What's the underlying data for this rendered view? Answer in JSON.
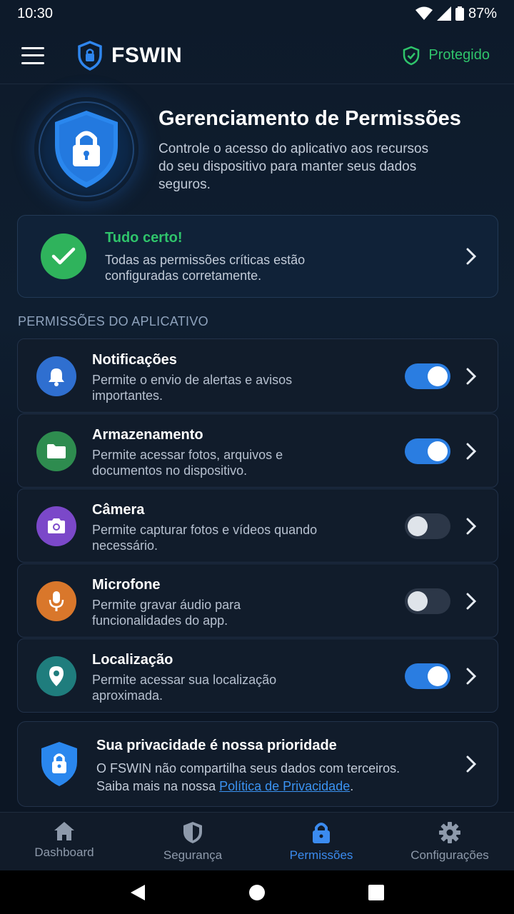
{
  "status_bar": {
    "time": "10:30",
    "battery": "87%"
  },
  "app_bar": {
    "brand": "FSWIN",
    "status": "Protegido"
  },
  "hero": {
    "title": "Gerenciamento de Permissões",
    "description": "Controle o acesso do aplicativo aos recursos do seu dispositivo para manter seus dados seguros."
  },
  "status_card": {
    "title": "Tudo certo!",
    "description": "Todas as permissões críticas estão configuradas corretamente."
  },
  "section_label": "PERMISSÕES DO APLICATIVO",
  "permissions": [
    {
      "title": "Notificações",
      "description": "Permite o envio de alertas e avisos importantes.",
      "enabled": true,
      "icon": "bell-icon",
      "color": "#2f6fd0"
    },
    {
      "title": "Armazenamento",
      "description": "Permite acessar fotos, arquivos e documentos no dispositivo.",
      "enabled": true,
      "icon": "folder-icon",
      "color": "#2e8c4f"
    },
    {
      "title": "Câmera",
      "description": "Permite capturar fotos e vídeos quando necessário.",
      "enabled": false,
      "icon": "camera-icon",
      "color": "#7b48c9"
    },
    {
      "title": "Microfone",
      "description": "Permite gravar áudio para funcionalidades do app.",
      "enabled": false,
      "icon": "microphone-icon",
      "color": "#d9772b"
    },
    {
      "title": "Localização",
      "description": "Permite acessar sua localização aproximada.",
      "enabled": true,
      "icon": "location-pin-icon",
      "color": "#1f7d7d"
    }
  ],
  "privacy": {
    "title": "Sua privacidade é nossa prioridade",
    "line1": "O FSWIN não compartilha seus dados com terceiros.",
    "line2_prefix": "Saiba mais na nossa ",
    "link": "Política de Privacidade",
    "line2_suffix": "."
  },
  "bottom_nav": [
    {
      "label": "Dashboard",
      "icon": "home-icon",
      "active": false
    },
    {
      "label": "Segurança",
      "icon": "shield-icon",
      "active": false
    },
    {
      "label": "Permissões",
      "icon": "lock-icon",
      "active": true
    },
    {
      "label": "Configurações",
      "icon": "gear-icon",
      "active": false
    }
  ],
  "colors": {
    "accent": "#2a7de1",
    "success": "#2fc46b",
    "background": "#0c1624"
  }
}
